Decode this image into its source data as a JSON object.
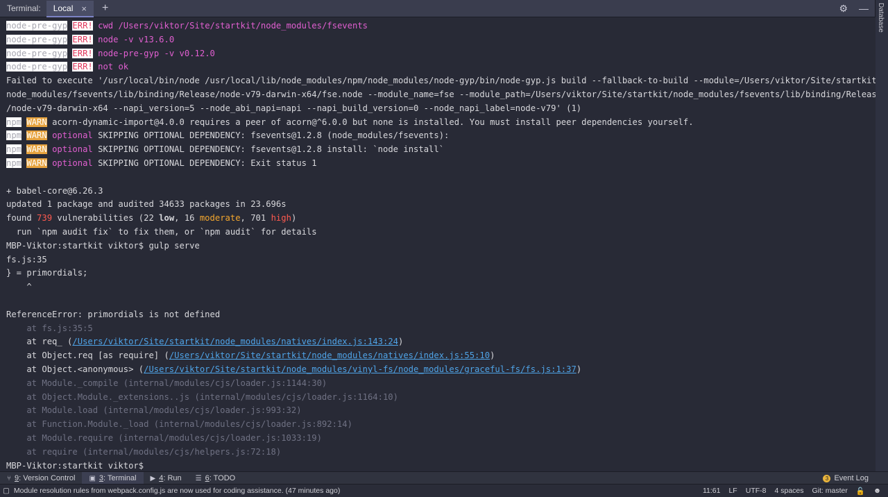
{
  "tabbar": {
    "title": "Terminal:",
    "active_tab": "Local",
    "close_glyph": "×",
    "add_glyph": "+",
    "icons": [
      "gear-icon",
      "minimize-icon"
    ]
  },
  "side_strip": {
    "label": "Database"
  },
  "terminal": {
    "err_prefix": "node-pre-gyp",
    "err_tag": "ERR!",
    "err_lines": [
      "cwd /Users/viktor/Site/startkit/node_modules/fsevents",
      "node -v v13.6.0",
      "node-pre-gyp -v v0.12.0",
      "not ok"
    ],
    "failed_lines": [
      "Failed to execute '/usr/local/bin/node /usr/local/lib/node_modules/npm/node_modules/node-gyp/bin/node-gyp.js build --fallback-to-build --module=/Users/viktor/Site/startkit/",
      "node_modules/fsevents/lib/binding/Release/node-v79-darwin-x64/fse.node --module_name=fse --module_path=/Users/viktor/Site/startkit/node_modules/fsevents/lib/binding/Release",
      "/node-v79-darwin-x64 --napi_version=5 --node_abi_napi=napi --napi_build_version=0 --node_napi_label=node-v79' (1)"
    ],
    "npm_prefix": "npm",
    "warn_tag": "WARN",
    "warn1": "acorn-dynamic-import@4.0.0 requires a peer of acorn@^6.0.0 but none is installed. You must install peer dependencies yourself.",
    "optional_word": "optional",
    "warn_optional": [
      "SKIPPING OPTIONAL DEPENDENCY: fsevents@1.2.8 (node_modules/fsevents):",
      "SKIPPING OPTIONAL DEPENDENCY: fsevents@1.2.8 install: `node install`",
      "SKIPPING OPTIONAL DEPENDENCY: Exit status 1"
    ],
    "added": "+ babel-core@6.26.3",
    "updated": "updated 1 package and audited 34633 packages in 23.696s",
    "found": {
      "prefix": "found ",
      "total": "739",
      "mid": " vulnerabilities (22 ",
      "low": "low",
      "sep1": ", 16 ",
      "moderate": "moderate",
      "sep2": ", 701 ",
      "high": "high",
      "suffix": ")"
    },
    "audit_hint": "  run `npm audit fix` to fix them, or `npm audit` for details",
    "prompt1": "MBP-Viktor:startkit viktor$ gulp serve",
    "fsjs": "fs.js:35",
    "primordials": "} = primordials;",
    "caret": "    ^",
    "ref_error": "ReferenceError: primordials is not defined",
    "stack_fs": "    at fs.js:35:5",
    "stack_links": [
      {
        "prefix": "    at req_ (",
        "link": "/Users/viktor/Site/startkit/node_modules/natives/index.js:143:24",
        "suffix": ")"
      },
      {
        "prefix": "    at Object.req [as require] (",
        "link": "/Users/viktor/Site/startkit/node_modules/natives/index.js:55:10",
        "suffix": ")"
      },
      {
        "prefix": "    at Object.<anonymous> (",
        "link": "/Users/viktor/Site/startkit/node_modules/vinyl-fs/node_modules/graceful-fs/fs.js:1:37",
        "suffix": ")"
      }
    ],
    "stack_internal": [
      "    at Module._compile (internal/modules/cjs/loader.js:1144:30)",
      "    at Object.Module._extensions..js (internal/modules/cjs/loader.js:1164:10)",
      "    at Module.load (internal/modules/cjs/loader.js:993:32)",
      "    at Function.Module._load (internal/modules/cjs/loader.js:892:14)",
      "    at Module.require (internal/modules/cjs/loader.js:1033:19)",
      "    at require (internal/modules/cjs/helpers.js:72:18)"
    ],
    "prompt2": "MBP-Viktor:startkit viktor$"
  },
  "statusbar": {
    "tools": [
      {
        "key": "9",
        "label": ": Version Control",
        "icon": "version-control-icon",
        "glyph": "⑂"
      },
      {
        "key": "3",
        "label": ": Terminal",
        "icon": "terminal-icon",
        "glyph": "▣"
      },
      {
        "key": "4",
        "label": ": Run",
        "icon": "run-icon",
        "glyph": "▶"
      },
      {
        "key": "6",
        "label": ": TODO",
        "icon": "todo-icon",
        "glyph": "☰"
      }
    ],
    "event_count": "3",
    "event_log": "Event Log"
  },
  "statusbar2": {
    "message": "Module resolution rules from webpack.config.js are now used for coding assistance. (47 minutes ago)",
    "position": "11:61",
    "line_sep": "LF",
    "encoding": "UTF-8",
    "indent": "4 spaces",
    "git": "Git: master"
  }
}
